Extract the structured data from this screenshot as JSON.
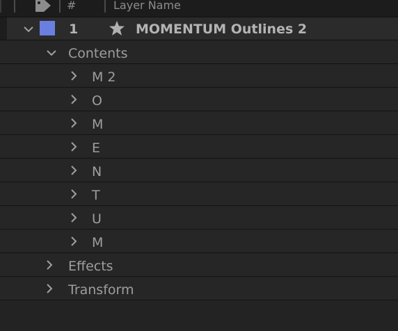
{
  "header": {
    "number_col": "#",
    "name_col": "Layer Name"
  },
  "layer": {
    "index": "1",
    "name": "MOMENTUM Outlines 2",
    "label_color": "#6b7fe0"
  },
  "contents": {
    "label": "Contents",
    "items": [
      "M 2",
      "O",
      "M",
      "E",
      "N",
      "T",
      "U",
      "M"
    ]
  },
  "effects": {
    "label": "Effects"
  },
  "transform": {
    "label": "Transform"
  },
  "icons": {
    "header_tag": "tag-icon",
    "expand_open": "chevron-down-icon",
    "expand_closed": "chevron-right-icon",
    "solo": "star-icon"
  }
}
